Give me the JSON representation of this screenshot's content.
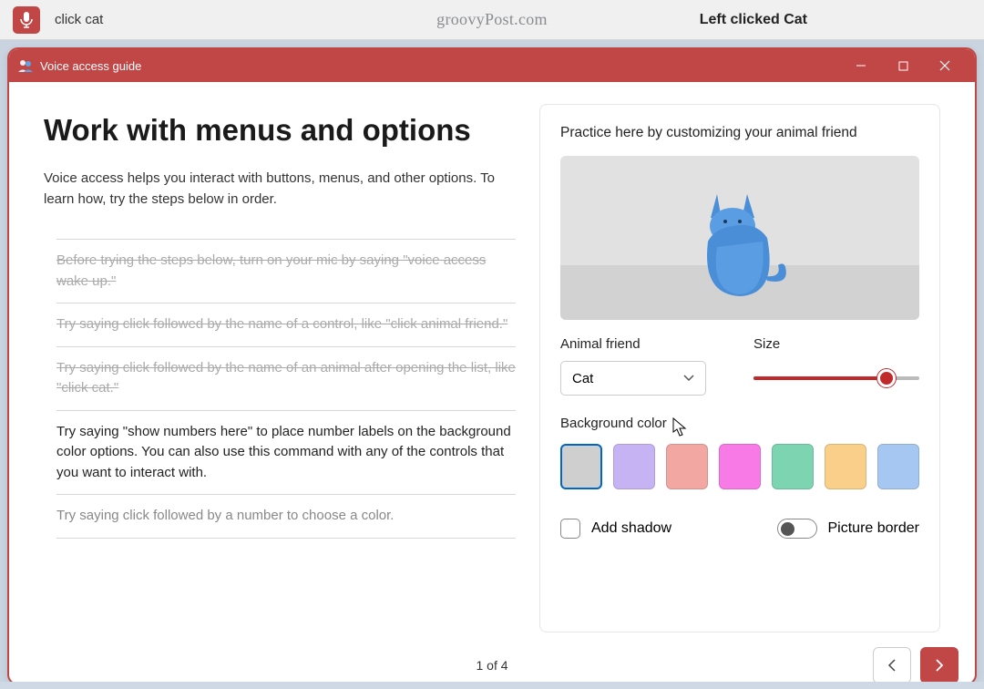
{
  "topbar": {
    "command": "click cat",
    "status": "Left clicked Cat"
  },
  "watermark": "groovyPost.com",
  "window": {
    "title": "Voice access guide"
  },
  "page": {
    "title": "Work with menus and options",
    "intro": "Voice access helps you interact with buttons, menus, and other options. To learn how, try the steps below in order."
  },
  "steps": [
    {
      "text": "Before trying the steps below, turn on your mic by saying \"voice access wake up.\"",
      "state": "done"
    },
    {
      "text": "Try saying click followed by the name of a control, like \"click animal friend.\"",
      "state": "done"
    },
    {
      "text": "Try saying click followed by the name of an animal after opening the list, like \"click cat.\"",
      "state": "done"
    },
    {
      "text": "Try saying \"show numbers here\" to place number labels on the background color options. You can also use this command with any of the controls that you want to interact with.",
      "state": "active"
    },
    {
      "text": "Try saying click followed by a number to choose a color.",
      "state": "faded"
    }
  ],
  "practice": {
    "heading": "Practice here by customizing your animal friend",
    "animal_label": "Animal friend",
    "animal_value": "Cat",
    "size_label": "Size",
    "bg_label": "Background color",
    "shadow_label": "Add shadow",
    "border_label": "Picture border"
  },
  "colors": [
    "#cfcfcf",
    "#c6b3f3",
    "#f2a7a3",
    "#f77ae6",
    "#7dd4b0",
    "#f9cf89",
    "#a6c7f2"
  ],
  "footer": {
    "indicator": "1 of 4"
  }
}
